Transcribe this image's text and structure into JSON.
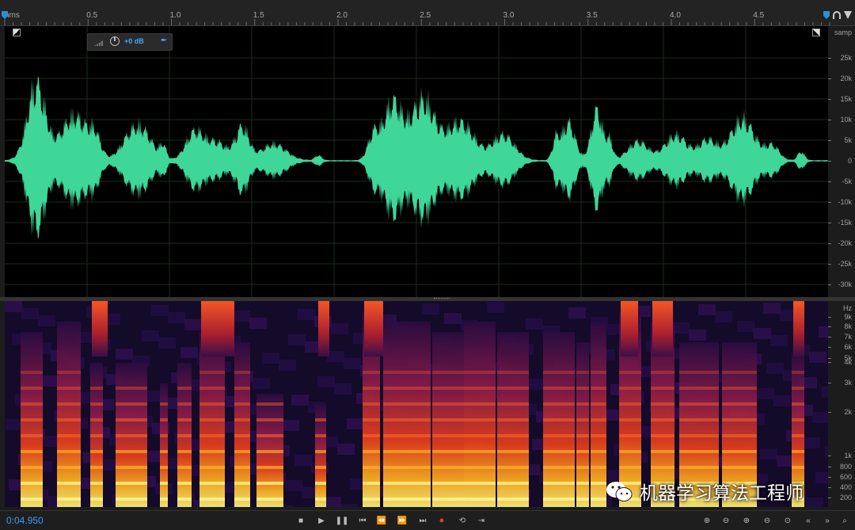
{
  "ruler": {
    "unit_label": "hms",
    "ticks": [
      "0.5",
      "1.0",
      "1.5",
      "2.0",
      "2.5",
      "3.0",
      "3.5",
      "4.0",
      "4.5"
    ],
    "tick_seconds": [
      0.5,
      1.0,
      1.5,
      2.0,
      2.5,
      3.0,
      3.5,
      4.0,
      4.5
    ]
  },
  "hud": {
    "gain_label": "+0 dB"
  },
  "waveform_scale": {
    "unit": "samp",
    "labels": [
      "25k",
      "20k",
      "15k",
      "10k",
      "5k",
      "0",
      "-5k",
      "-10k",
      "-15k",
      "-20k",
      "-25k",
      "-30k"
    ]
  },
  "spectral_scale": {
    "unit": "Hz",
    "labels": [
      "9k",
      "8k",
      "7k",
      "6k",
      "5k",
      "4k",
      "3k",
      "2k",
      "1k",
      "800",
      "600",
      "400",
      "200"
    ]
  },
  "transport": {
    "current_time": "0:04.950",
    "buttons": [
      "stop",
      "play",
      "pause",
      "go-to-start",
      "rewind",
      "fast-forward",
      "go-to-end",
      "record",
      "loop",
      "skip"
    ]
  },
  "watermark": {
    "text": "机器学习算法工程师"
  },
  "colors": {
    "waveform": "#3fd69a",
    "accent": "#2d8fd6",
    "record": "#e23b3b"
  }
}
